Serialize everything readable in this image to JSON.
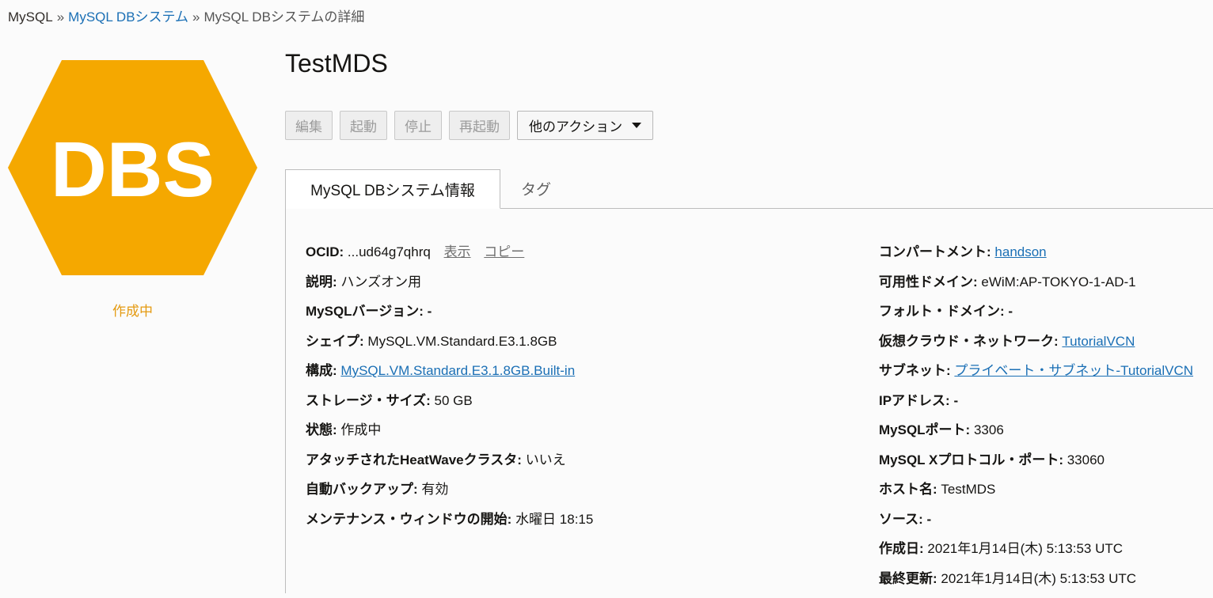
{
  "breadcrumb": {
    "root": "MySQL",
    "sep1": "»",
    "link": "MySQL DBシステム",
    "sep2": "»",
    "current": "MySQL DBシステムの詳細"
  },
  "badge": {
    "text": "DBS",
    "color": "#f5a800",
    "status": "作成中",
    "status_color": "#e49a10"
  },
  "title": "TestMDS",
  "actions": {
    "edit": "編集",
    "start": "起動",
    "stop": "停止",
    "restart": "再起動",
    "more": "他のアクション"
  },
  "tabs": {
    "info": "MySQL DBシステム情報",
    "tags": "タグ"
  },
  "details_left": {
    "ocid_label": "OCID:",
    "ocid_value": "...ud64g7qhrq",
    "show": "表示",
    "copy": "コピー",
    "description_label": "説明:",
    "description_value": "ハンズオン用",
    "version_label": "MySQLバージョン:",
    "version_value": "-",
    "shape_label": "シェイプ:",
    "shape_value": "MySQL.VM.Standard.E3.1.8GB",
    "config_label": "構成:",
    "config_value": "MySQL.VM.Standard.E3.1.8GB.Built-in",
    "storage_label": "ストレージ・サイズ:",
    "storage_value": "50 GB",
    "state_label": "状態:",
    "state_value": "作成中",
    "heatwave_label": "アタッチされたHeatWaveクラスタ:",
    "heatwave_value": "いいえ",
    "backup_label": "自動バックアップ:",
    "backup_value": "有効",
    "maintenance_label": "メンテナンス・ウィンドウの開始:",
    "maintenance_value": "水曜日 18:15"
  },
  "details_right": {
    "compartment_label": "コンパートメント:",
    "compartment_value": "handson",
    "ad_label": "可用性ドメイン:",
    "ad_value": "eWiM:AP-TOKYO-1-AD-1",
    "fd_label": "フォルト・ドメイン:",
    "fd_value": "-",
    "vcn_label": "仮想クラウド・ネットワーク:",
    "vcn_value": "TutorialVCN",
    "subnet_label": "サブネット:",
    "subnet_value": "プライベート・サブネット-TutorialVCN",
    "ip_label": "IPアドレス:",
    "ip_value": "-",
    "port_label": "MySQLポート:",
    "port_value": "3306",
    "xport_label": "MySQL Xプロトコル・ポート:",
    "xport_value": "33060",
    "host_label": "ホスト名:",
    "host_value": "TestMDS",
    "source_label": "ソース:",
    "source_value": "-",
    "created_label": "作成日:",
    "created_value": "2021年1月14日(木) 5:13:53 UTC",
    "updated_label": "最終更新:",
    "updated_value": "2021年1月14日(木) 5:13:53 UTC"
  }
}
